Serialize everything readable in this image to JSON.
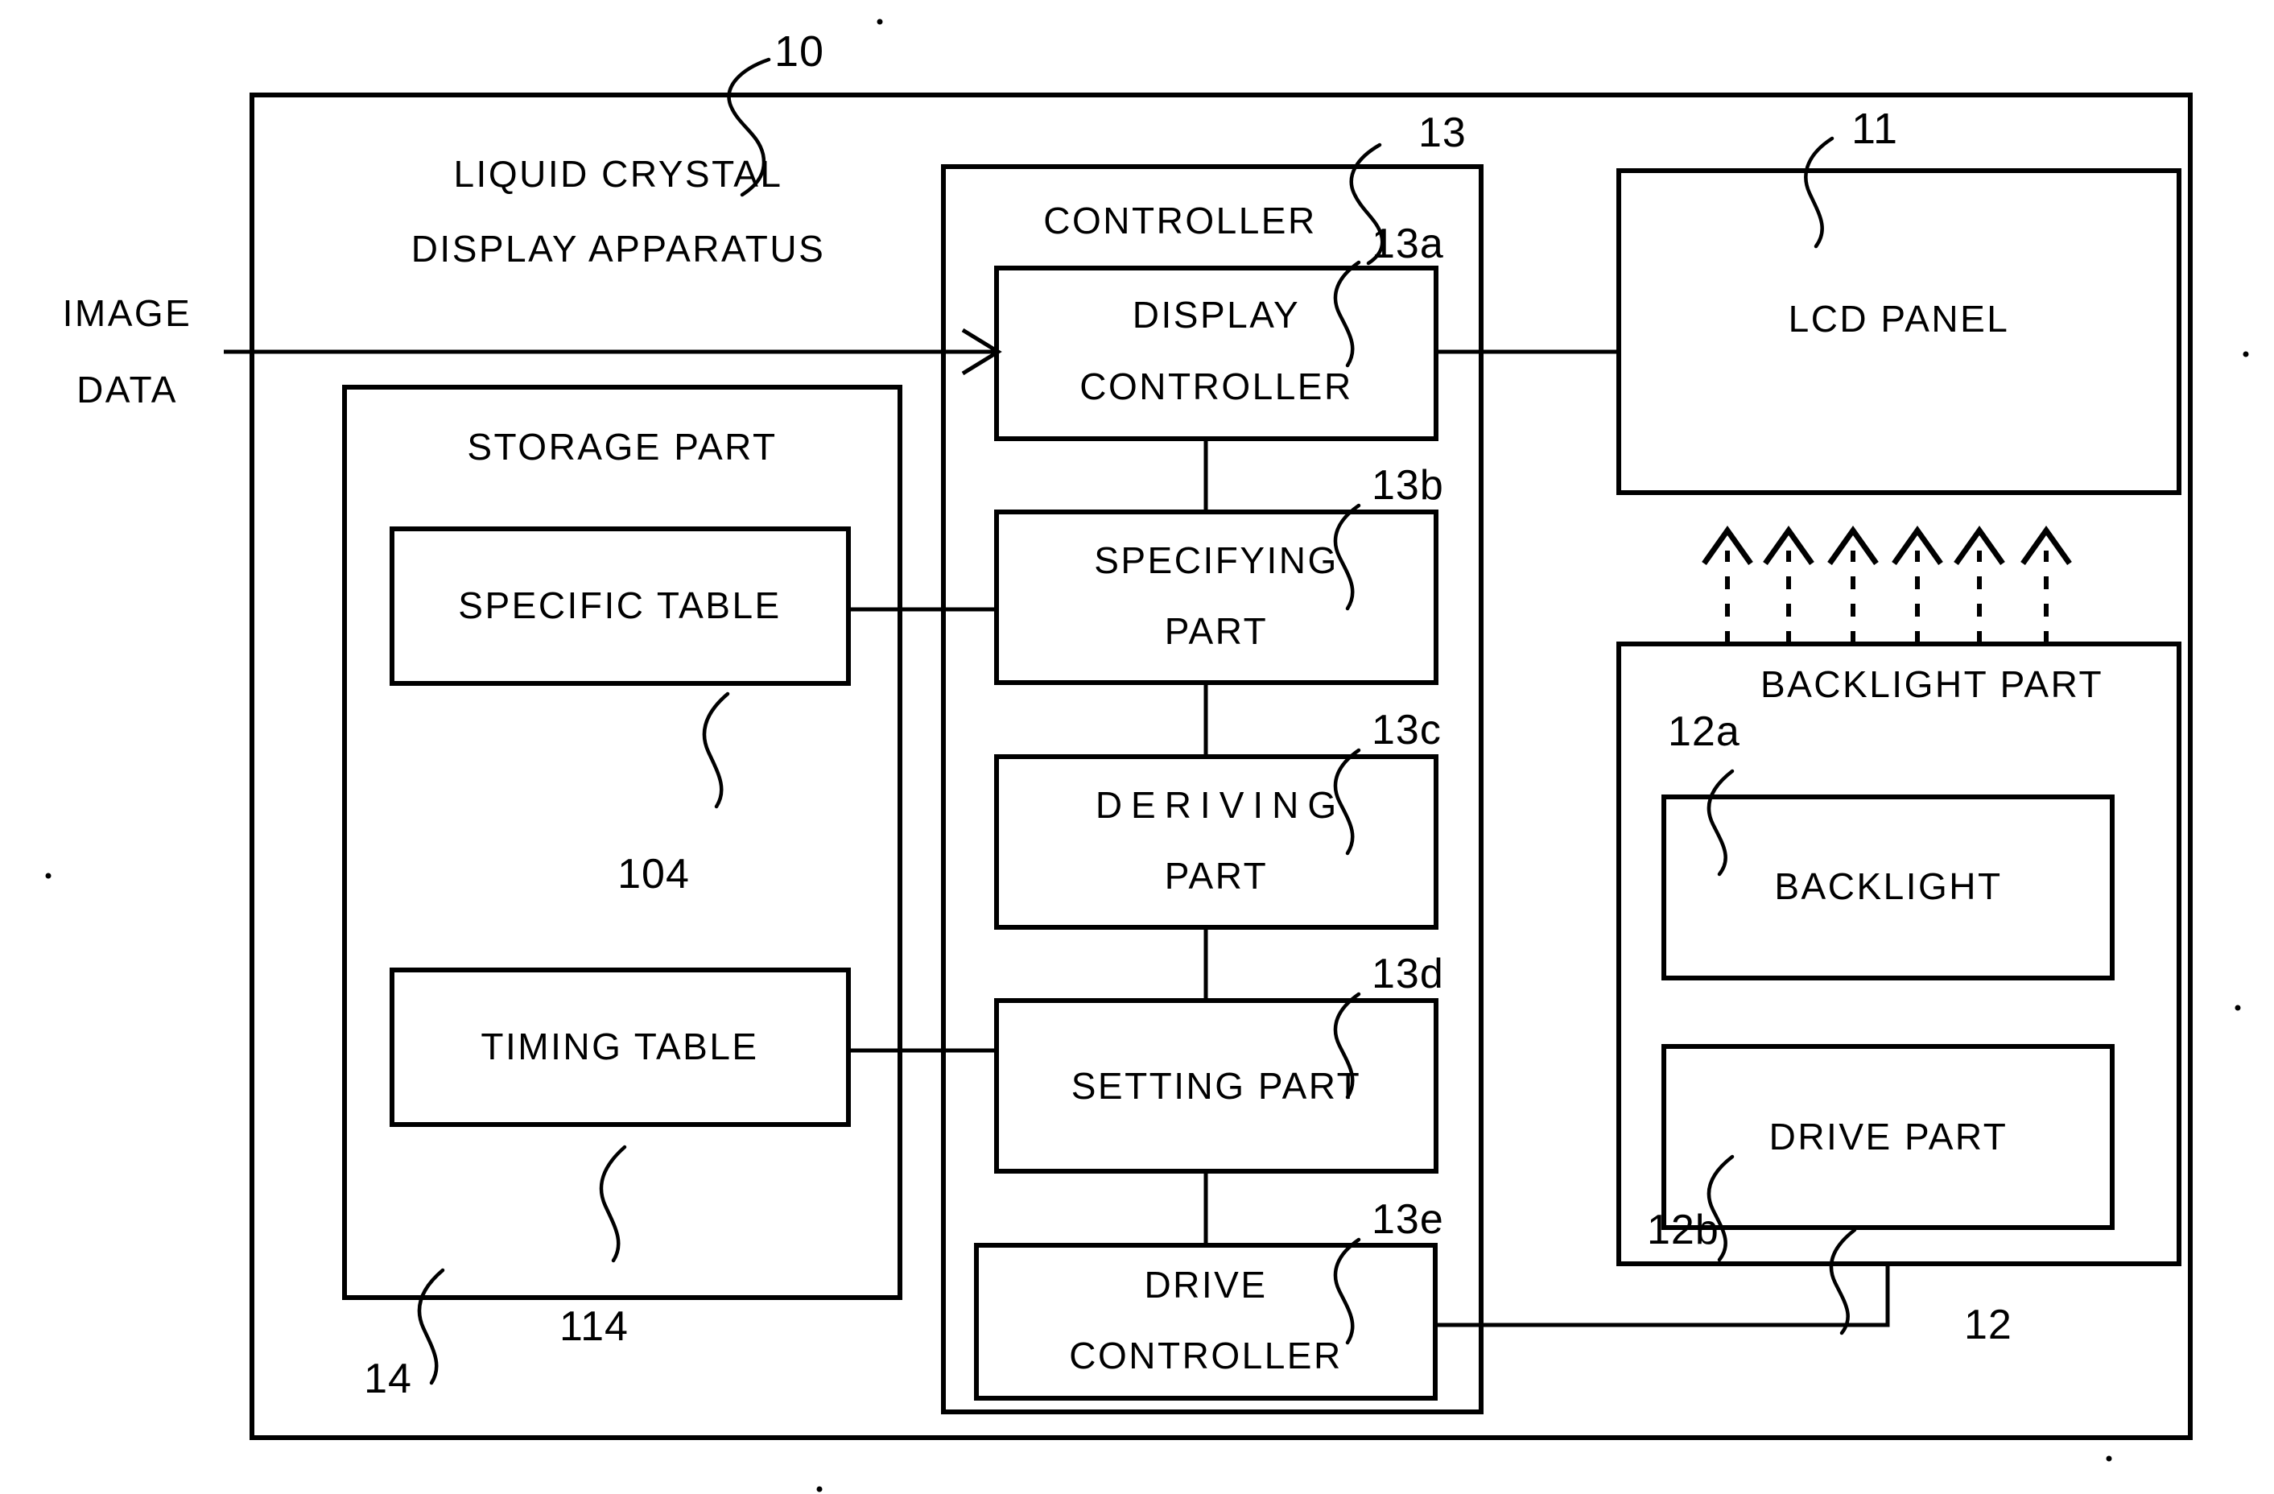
{
  "figure": {
    "title": "Liquid crystal display apparatus block diagram",
    "outer": {
      "label_line1": "LIQUID CRYSTAL",
      "label_line2": "DISPLAY APPARATUS",
      "ref": "10"
    },
    "input": {
      "label_line1": "IMAGE",
      "label_line2": "DATA"
    },
    "storage": {
      "title": "STORAGE PART",
      "ref": "14",
      "tables": [
        {
          "label": "SPECIFIC TABLE",
          "ref": "104"
        },
        {
          "label": "TIMING TABLE",
          "ref": "114"
        }
      ]
    },
    "controller": {
      "title": "CONTROLLER",
      "ref": "13",
      "blocks": [
        {
          "line1": "DISPLAY",
          "line2": "CONTROLLER",
          "ref": "13a"
        },
        {
          "line1": "SPECIFYING",
          "line2": "PART",
          "ref": "13b"
        },
        {
          "line1": "DERIVING",
          "line2": "PART",
          "ref": "13c"
        },
        {
          "line1": "SETTING PART",
          "line2": "",
          "ref": "13d"
        },
        {
          "line1": "DRIVE",
          "line2": "CONTROLLER",
          "ref": "13e"
        }
      ]
    },
    "lcd_panel": {
      "label": "LCD PANEL",
      "ref": "11"
    },
    "backlight_part": {
      "title": "BACKLIGHT PART",
      "ref": "12",
      "blocks": [
        {
          "label": "BACKLIGHT",
          "ref": "12a"
        },
        {
          "label": "DRIVE PART",
          "ref": "12b"
        }
      ]
    },
    "light_arrows": {
      "count": 6,
      "description": "dashed upward arrows from backlight part to lcd panel"
    },
    "colors": {
      "stroke": "#000000",
      "background": "#ffffff"
    }
  }
}
